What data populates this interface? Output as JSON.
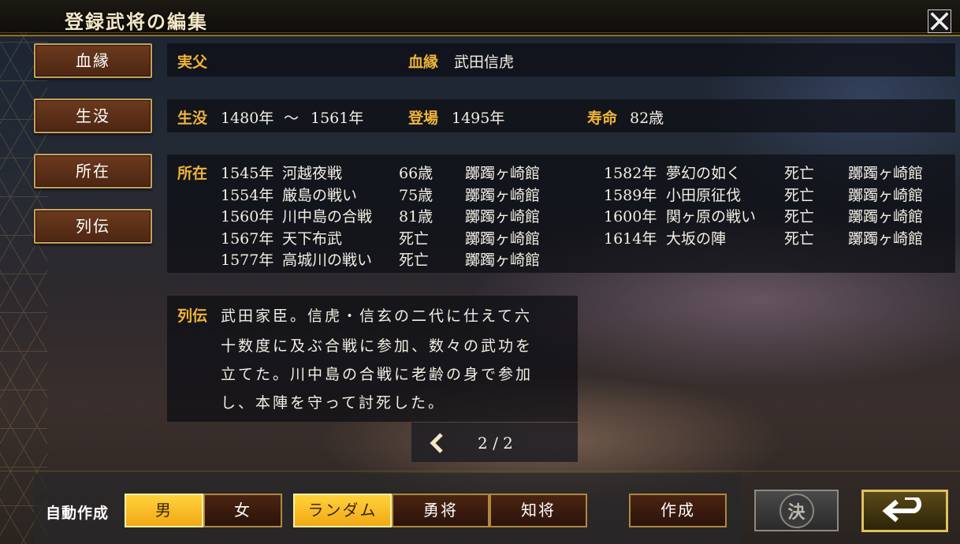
{
  "title": "登録武将の編集",
  "sidebar": [
    "血縁",
    "生没",
    "所在",
    "列伝"
  ],
  "kinship": {
    "father_label": "実父",
    "bloodline_label": "血縁",
    "bloodline_value": "武田信虎"
  },
  "lifespan": {
    "label": "生没",
    "birth": "1480年",
    "sep": "～",
    "death": "1561年",
    "debut_label": "登場",
    "debut": "1495年",
    "life_label": "寿命",
    "life": "82歳"
  },
  "location": {
    "label": "所在",
    "left": [
      {
        "year": "1545年",
        "event": "河越夜戦",
        "age": "66歳",
        "place": "躑躅ヶ崎館"
      },
      {
        "year": "1554年",
        "event": "厳島の戦い",
        "age": "75歳",
        "place": "躑躅ヶ崎館"
      },
      {
        "year": "1560年",
        "event": "川中島の合戦",
        "age": "81歳",
        "place": "躑躅ヶ崎館"
      },
      {
        "year": "1567年",
        "event": "天下布武",
        "age": "死亡",
        "place": "躑躅ヶ崎館"
      },
      {
        "year": "1577年",
        "event": "高城川の戦い",
        "age": "死亡",
        "place": "躑躅ヶ崎館"
      }
    ],
    "right": [
      {
        "year": "1582年",
        "event": "夢幻の如く",
        "age": "死亡",
        "place": "躑躅ヶ崎館"
      },
      {
        "year": "1589年",
        "event": "小田原征伐",
        "age": "死亡",
        "place": "躑躅ヶ崎館"
      },
      {
        "year": "1600年",
        "event": "関ヶ原の戦い",
        "age": "死亡",
        "place": "躑躅ヶ崎館"
      },
      {
        "year": "1614年",
        "event": "大坂の陣",
        "age": "死亡",
        "place": "躑躅ヶ崎館"
      }
    ]
  },
  "biography": {
    "label": "列伝",
    "lines": [
      "武田家臣。信虎・信玄の二代に仕えて六",
      "十数度に及ぶ合戦に参加、数々の武功を",
      "立てた。川中島の合戦に老齢の身で参加",
      "し、本陣を守って討死した。"
    ]
  },
  "pager": {
    "text": "2 / 2"
  },
  "footer": {
    "auto_label": "自動作成",
    "male": "男",
    "female": "女",
    "random": "ランダム",
    "brave": "勇将",
    "wise": "知将",
    "create": "作成",
    "kessen": "決"
  },
  "colors": {
    "accent": "#f0b43a",
    "selected": "#ffc928"
  }
}
